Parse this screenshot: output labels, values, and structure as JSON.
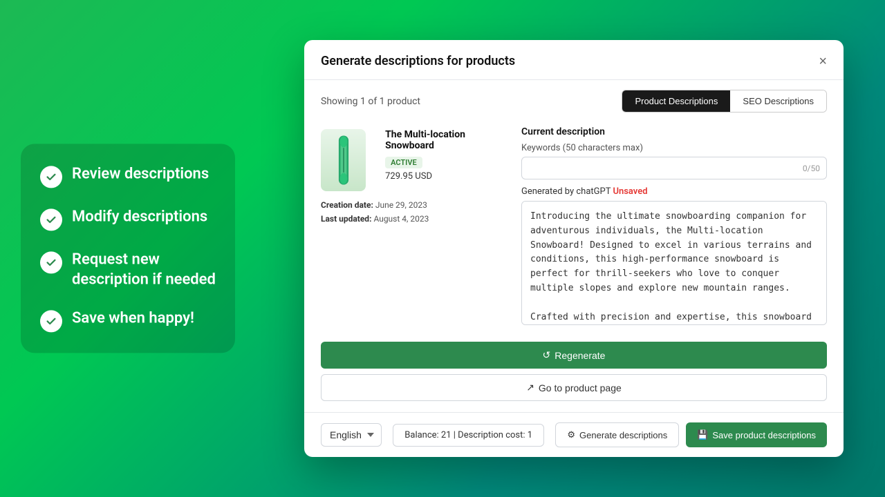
{
  "background": {
    "gradient_start": "#1db954",
    "gradient_end": "#00796b"
  },
  "left_panel": {
    "items": [
      {
        "id": "review",
        "label": "Review descriptions"
      },
      {
        "id": "modify",
        "label": "Modify descriptions"
      },
      {
        "id": "request",
        "label": "Request new description if needed"
      },
      {
        "id": "save",
        "label": "Save when happy!"
      }
    ]
  },
  "modal": {
    "title": "Generate descriptions for products",
    "close_label": "×",
    "showing_text": "Showing 1 of 1 product",
    "tabs": [
      {
        "id": "product",
        "label": "Product Descriptions",
        "active": true
      },
      {
        "id": "seo",
        "label": "SEO Descriptions",
        "active": false
      }
    ],
    "product": {
      "name": "The Multi-location Snowboard",
      "status": "ACTIVE",
      "price": "729.95 USD",
      "creation_date_label": "Creation date:",
      "creation_date": "June 29, 2023",
      "last_updated_label": "Last updated:",
      "last_updated": "August 4, 2023"
    },
    "description_panel": {
      "current_description_label": "Current description",
      "keywords_label": "Keywords (50 characters max)",
      "keywords_value": "",
      "keywords_placeholder": "",
      "char_count": "0/50",
      "generated_label": "Generated by chatGPT",
      "unsaved_label": "Unsaved",
      "generated_text": "Introducing the ultimate snowboarding companion for adventurous individuals, the Multi-location Snowboard! Designed to excel in various terrains and conditions, this high-performance snowboard is perfect for thrill-seekers who love to conquer multiple slopes and explore new mountain ranges.\n\nCrafted with precision and expertise, this snowboard features a versatile shape that ensures stability and control, making it suitable for riders of all levels, from beginners to seasoned veterans. The size and flex pattern of the board have been meticulously optimized to deliver optimal performance and maximize your riding experience.\n\nOne of the standout features of this snowboard is its innovative base technology."
    },
    "buttons": {
      "regenerate": "Regenerate",
      "goto_product": "Go to product page",
      "generate_descriptions": "Generate descriptions",
      "save_product_descriptions": "Save product descriptions"
    },
    "footer": {
      "language": "English",
      "balance_text": "Balance: 21 | Description cost: 1"
    }
  }
}
